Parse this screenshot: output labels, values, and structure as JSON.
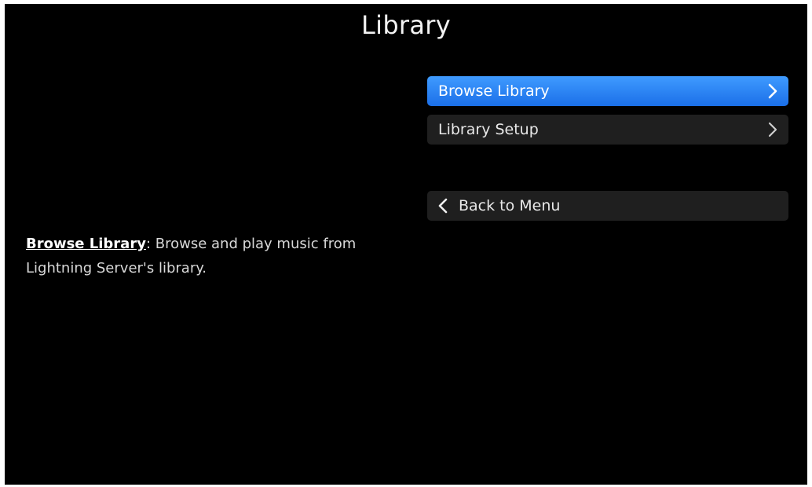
{
  "page": {
    "title": "Library"
  },
  "menu": {
    "items": [
      {
        "label": "Browse Library",
        "selected": true,
        "icon": "chevron-right-icon"
      },
      {
        "label": "Library Setup",
        "selected": false,
        "icon": "chevron-right-icon"
      }
    ],
    "back": {
      "label": "Back to Menu",
      "icon": "chevron-left-icon"
    }
  },
  "description": {
    "term": "Browse Library",
    "text": ": Browse  and play music from Lightning Server's library."
  },
  "colors": {
    "background": "#000000",
    "selected_item": "#2a82f6",
    "item": "#1f1f1f",
    "text": "#e8e8e8"
  }
}
